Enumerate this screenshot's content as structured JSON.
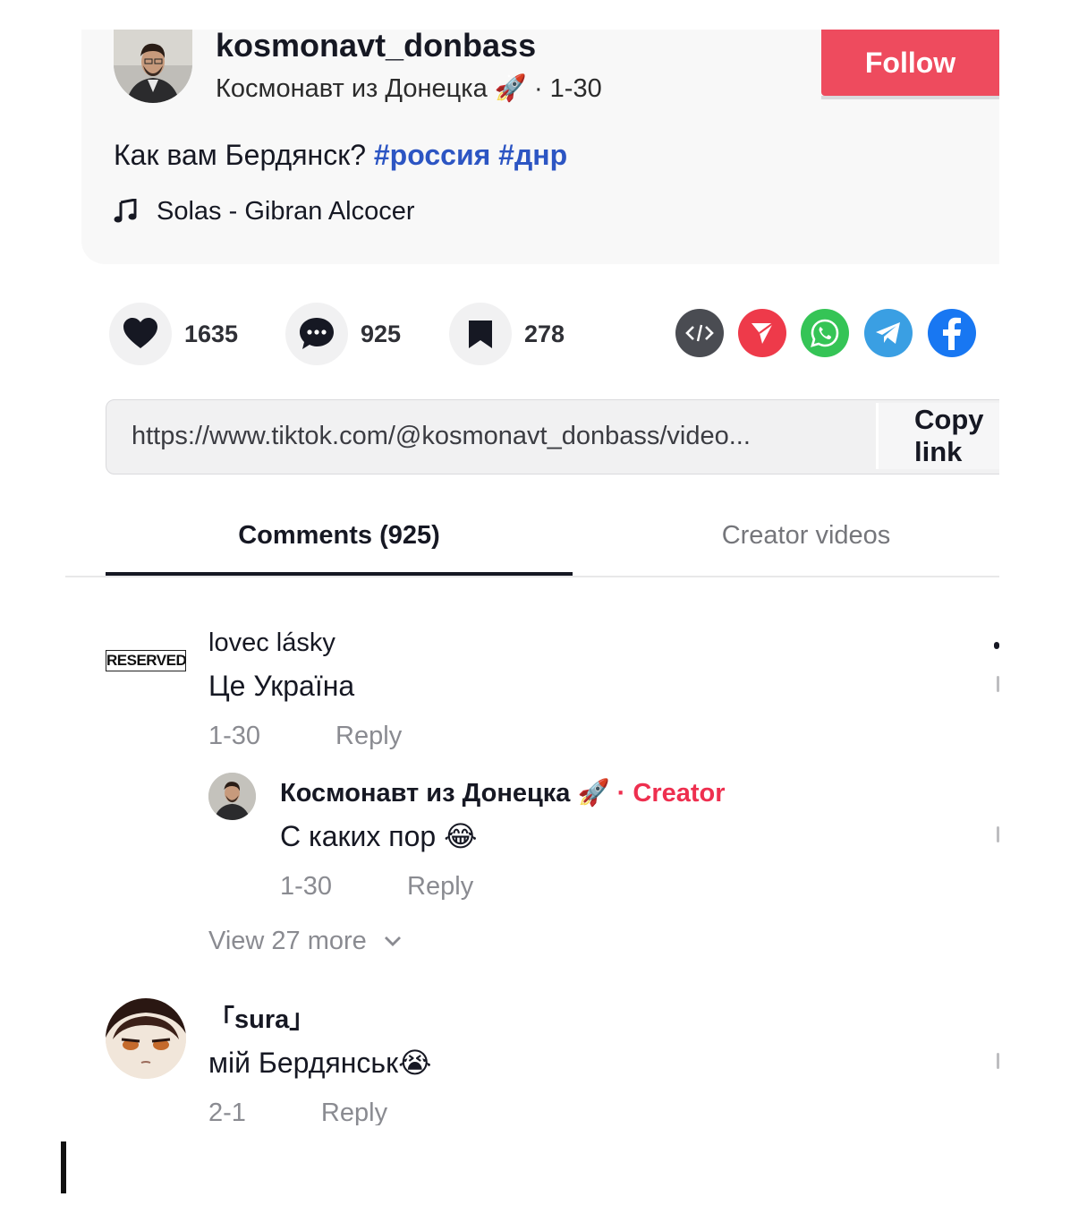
{
  "post": {
    "username": "kosmonavt_donbass",
    "display_name": "Космонавт из Донецка",
    "display_emoji": "🚀",
    "date": "· 1-30",
    "follow_label": "Follow",
    "caption_text": "Как вам Бердянск?",
    "hashtags": [
      "#россия",
      "#днр"
    ],
    "music": "Solas - Gibran Alcocer"
  },
  "actions": {
    "likes": "1635",
    "comments": "925",
    "saves": "278"
  },
  "share_icons": [
    "embed-icon",
    "send-icon",
    "whatsapp-icon",
    "telegram-icon",
    "facebook-icon"
  ],
  "link": {
    "url": "https://www.tiktok.com/@kosmonavt_donbass/video...",
    "copy_label": "Copy link"
  },
  "tabs": {
    "comments": "Comments (925)",
    "creator_videos": "Creator videos"
  },
  "comments": [
    {
      "badge": "RESERVED",
      "name": "lovec lásky",
      "text": "Це Україна",
      "date": "1-30",
      "reply_label": "Reply",
      "reply": {
        "name": "Космонавт из Донецка 🚀",
        "creator_tag": "· Creator",
        "text": "С каких пор 😂",
        "date": "1-30",
        "reply_label": "Reply"
      },
      "view_more": "View 27 more"
    },
    {
      "name": "「sura」",
      "text": "мій Бердянськ😭",
      "date": "2-1",
      "reply_label": "Reply"
    }
  ],
  "colors": {
    "follow": "#ee4b5e",
    "hashtag": "#2c55c3",
    "creator": "#ee2f4f",
    "embed": "#4a4c52",
    "send": "#ee3a4a",
    "whatsapp": "#35c456",
    "telegram": "#3a9fe3",
    "facebook": "#1877f2"
  }
}
